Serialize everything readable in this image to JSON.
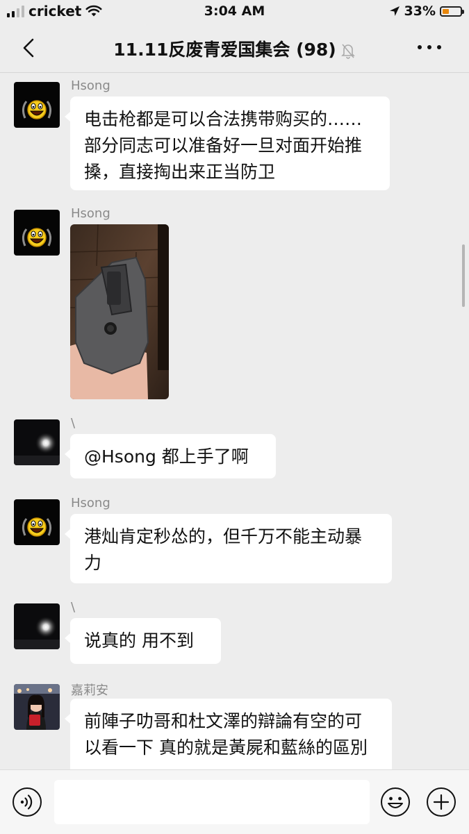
{
  "status": {
    "carrier": "cricket",
    "time": "3:04 AM",
    "battery": "33%",
    "battery_level": 0.33
  },
  "header": {
    "title": "11.11反废青爱国集会 (98)"
  },
  "messages": [
    {
      "sender": "Hsong",
      "text": "电击枪都是可以合法携带购买的……部分同志可以准备好一旦对面开始推搡，直接掏出来正当防卫"
    },
    {
      "sender": "Hsong",
      "image": "holster-photo"
    },
    {
      "sender": "\\",
      "text": "@Hsong 都上手了啊"
    },
    {
      "sender": "Hsong",
      "text": "港灿肯定秒怂的，但千万不能主动暴力"
    },
    {
      "sender": "\\",
      "text": "说真的 用不到"
    },
    {
      "sender": "嘉莉安",
      "text": "前陣子叻哥和杜文澤的辯論有空的可以看一下 真的就是黃屍和藍絲的區別"
    }
  ],
  "input": {
    "placeholder": ""
  },
  "icons": {
    "back": "chevron-left-icon",
    "mute": "bell-slash-icon",
    "more": "more-dots-icon",
    "voice": "voice-icon",
    "emoji": "emoji-icon",
    "plus": "plus-icon"
  }
}
